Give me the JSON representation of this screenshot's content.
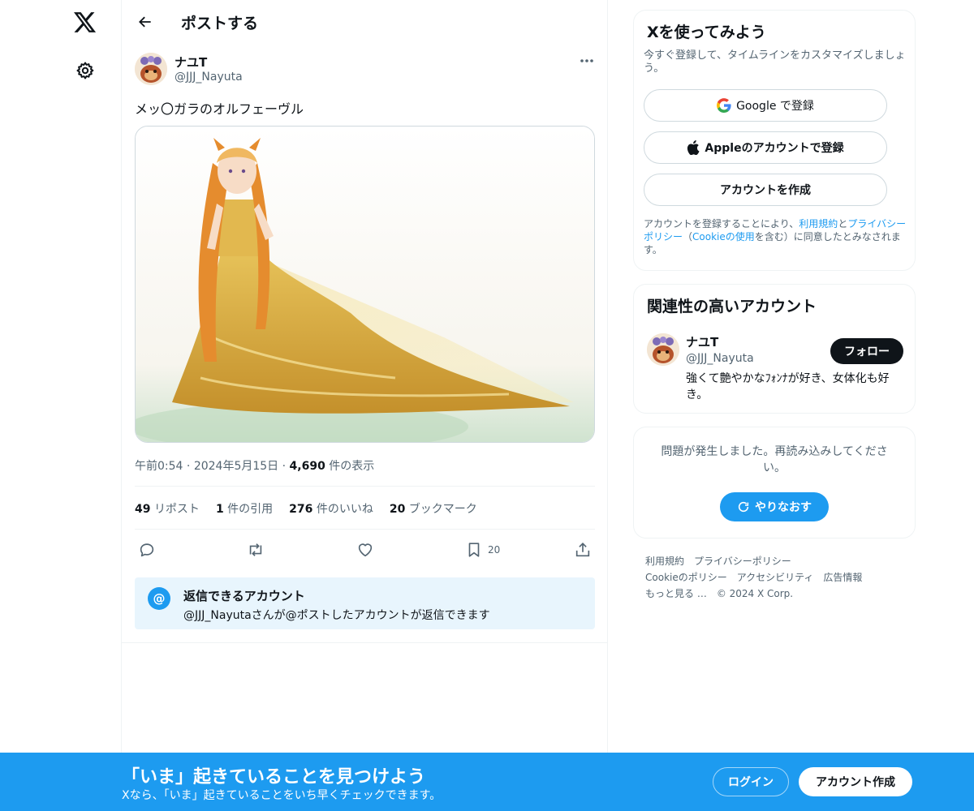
{
  "nav": {
    "logo_icon": "x-logo-icon",
    "settings_icon": "gear-icon"
  },
  "header": {
    "title": "ポストする",
    "back_icon": "arrow-left-icon"
  },
  "post": {
    "author_name": "ナユT",
    "author_handle": "@JJJ_Nayuta",
    "text": "メッ〇ガラのオルフェーヴル",
    "media_description_icon": "image-icon",
    "time": "午前0:54",
    "date": "2024年5月15日",
    "views_count": "4,690",
    "views_label": "件の表示",
    "separator": "·",
    "stats": [
      {
        "count": "49",
        "label": "リポスト"
      },
      {
        "count": "1",
        "label": "件の引用"
      },
      {
        "count": "276",
        "label": "件のいいね"
      },
      {
        "count": "20",
        "label": "ブックマーク"
      }
    ],
    "actions": {
      "reply_icon": "reply-icon",
      "repost_icon": "repost-icon",
      "like_icon": "heart-icon",
      "bookmark_icon": "bookmark-icon",
      "bookmark_count": "20",
      "share_icon": "share-icon"
    },
    "reply_restriction": {
      "icon": "@",
      "title": "返信できるアカウント",
      "description": "@JJJ_Nayutaさんが@ポストしたアカウントが返信できます"
    }
  },
  "signup_card": {
    "title": "Xを使ってみよう",
    "subtitle": "今すぐ登録して、タイムラインをカスタマイズしましょう。",
    "google_label": "Google で登録",
    "apple_label": "Appleのアカウントで登録",
    "create_label": "アカウントを作成",
    "terms_1": "アカウントを登録することにより、",
    "terms_link_1": "利用規約",
    "terms_2": "と",
    "terms_link_2": "プライバシーポリシー",
    "terms_3": "（",
    "terms_link_3": "Cookieの使用",
    "terms_4": "を含む）に同意したとみなされます。"
  },
  "related_card": {
    "title": "関連性の高いアカウント",
    "name": "ナユT",
    "handle": "@JJJ_Nayuta",
    "follow_label": "フォロー",
    "bio": "強くて艶やかなﾌｫﾝﾅが好き、女体化も好き。"
  },
  "error_card": {
    "message": "問題が発生しました。再読み込みしてください。",
    "retry_label": "やりなおす"
  },
  "footer": {
    "links": [
      "利用規約",
      "プライバシーポリシー",
      "Cookieのポリシー",
      "アクセシビリティ",
      "広告情報",
      "もっと見る …",
      "© 2024 X Corp."
    ]
  },
  "banner": {
    "title": "「いま」起きていることを見つけよう",
    "subtitle": "Xなら、「いま」起きていることをいち早くチェックできます。",
    "login_label": "ログイン",
    "signup_label": "アカウント作成"
  },
  "colors": {
    "accent": "#1d9bf0",
    "text": "#0f1419",
    "muted": "#536471",
    "border": "#eff3f4"
  }
}
